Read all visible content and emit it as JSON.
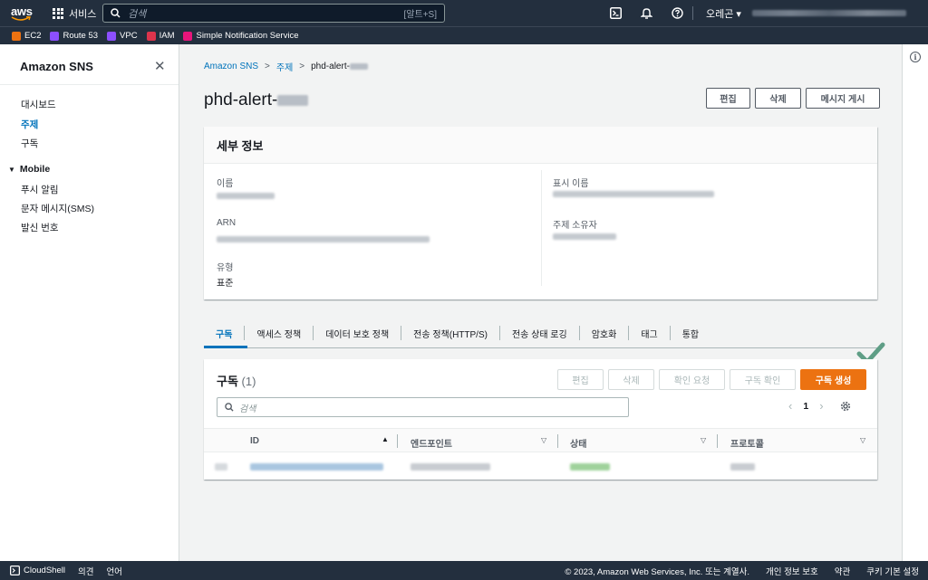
{
  "topnav": {
    "logo": "aws",
    "services_label": "서비스",
    "search_placeholder": "검색",
    "search_shortcut": "[알트+S]",
    "region_label": "오레곤 ▾"
  },
  "favorites": [
    {
      "label": "EC2",
      "color": "#ec7211"
    },
    {
      "label": "Route 53",
      "color": "#8c4fff"
    },
    {
      "label": "VPC",
      "color": "#8c4fff"
    },
    {
      "label": "IAM",
      "color": "#dd344c"
    },
    {
      "label": "Simple Notification Service",
      "color": "#e7157b"
    }
  ],
  "sidebar": {
    "title": "Amazon SNS",
    "items": [
      {
        "label": "대시보드"
      },
      {
        "label": "주제"
      },
      {
        "label": "구독"
      }
    ],
    "mobile_section": "Mobile",
    "mobile_items": [
      {
        "label": "푸시 알림"
      },
      {
        "label": "문자 메시지(SMS)"
      },
      {
        "label": "발신 번호"
      }
    ]
  },
  "breadcrumb": {
    "root": "Amazon SNS",
    "topics": "주제",
    "current": "phd-alert-"
  },
  "page": {
    "title": "phd-alert-",
    "buttons": {
      "edit": "편집",
      "delete": "삭제",
      "publish": "메시지 게시"
    }
  },
  "details": {
    "header": "세부 정보",
    "name_label": "이름",
    "arn_label": "ARN",
    "type_label": "유형",
    "type_value": "표준",
    "display_name_label": "표시 이름",
    "owner_label": "주제 소유자"
  },
  "tabs": [
    "구독",
    "액세스 정책",
    "데이터 보호 정책",
    "전송 정책(HTTP/S)",
    "전송 상태 로깅",
    "암호화",
    "태그",
    "통합"
  ],
  "subscriptions": {
    "title": "구독",
    "count": "(1)",
    "buttons": {
      "edit": "편집",
      "delete": "삭제",
      "request_confirm": "확인 요청",
      "confirm": "구독 확인",
      "create": "구독 생성"
    },
    "filter_placeholder": "검색",
    "page_number": "1",
    "columns": [
      "ID",
      "엔드포인트",
      "상태",
      "프로토콜"
    ]
  },
  "footer": {
    "cloudshell": "CloudShell",
    "feedback": "의견",
    "language": "언어",
    "copyright": "© 2023, Amazon Web Services, Inc. 또는 계열사.",
    "privacy": "개인 정보 보호",
    "terms": "약관",
    "cookies": "쿠키 기본 설정"
  }
}
